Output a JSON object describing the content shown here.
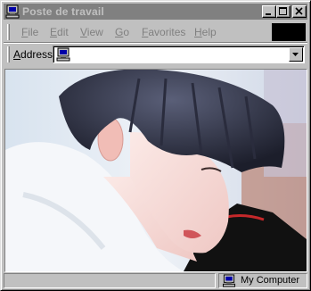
{
  "window": {
    "title": "Poste de travail",
    "icon": "computer-icon"
  },
  "menu": {
    "items": [
      {
        "label": "File"
      },
      {
        "label": "Edit"
      },
      {
        "label": "View"
      },
      {
        "label": "Go"
      },
      {
        "label": "Favorites"
      },
      {
        "label": "Help"
      }
    ]
  },
  "address": {
    "label_first": "A",
    "label_rest": "ddress",
    "value": "",
    "icon": "computer-icon"
  },
  "content": {
    "image": "photo of a dark-haired person leaning forward, wearing a white hoodie"
  },
  "status": {
    "left_text": "",
    "zone": "My Computer",
    "zone_icon": "computer-icon"
  },
  "colors": {
    "face": "#c0c0c0",
    "title_inactive": "#808080",
    "title_text": "#c0c0c0"
  }
}
